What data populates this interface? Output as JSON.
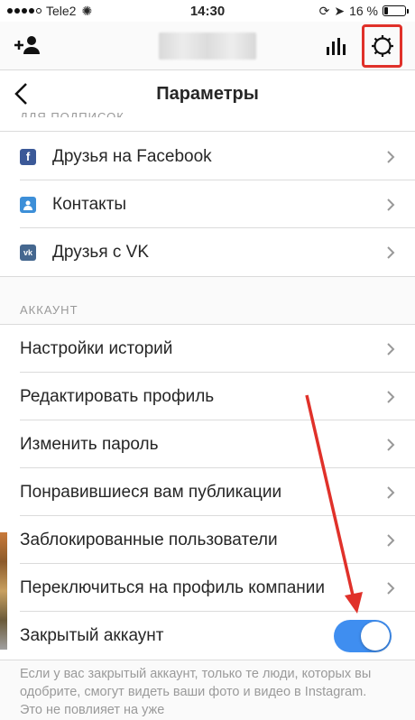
{
  "status_bar": {
    "carrier": "Tele2",
    "time": "14:30",
    "battery_text": "16 %",
    "battery_level": 0.16
  },
  "top_bar": {
    "icons": [
      "add-user-icon",
      "stats-icon",
      "gear-icon"
    ],
    "highlight_color": "#e0312a"
  },
  "nav": {
    "title": "Параметры"
  },
  "sections": {
    "follow": {
      "header_clipped": "ДЛЯ ПОДПИСОК",
      "items": [
        {
          "label": "Друзья на Facebook",
          "icon": "facebook-icon"
        },
        {
          "label": "Контакты",
          "icon": "contacts-icon"
        },
        {
          "label": "Друзья с VK",
          "icon": "vk-icon"
        }
      ]
    },
    "account": {
      "header": "АККАУНТ",
      "items": [
        {
          "label": "Настройки историй"
        },
        {
          "label": "Редактировать профиль"
        },
        {
          "label": "Изменить пароль"
        },
        {
          "label": "Понравившиеся вам публикации"
        },
        {
          "label": "Заблокированные пользователи"
        },
        {
          "label": "Переключиться на профиль компании"
        }
      ],
      "private_toggle": {
        "label": "Закрытый аккаунт",
        "on": true
      },
      "footnote": "Если у вас закрытый аккаунт, только те люди, которых вы одобрите, смогут видеть ваши фото и видео в Instagram. Это не повлияет на уже"
    }
  },
  "colors": {
    "accent": "#3f8ef0",
    "facebook": "#3b5998",
    "contacts": "#3d8fd8",
    "vk": "#45678f",
    "annotation_arrow": "#e0312a"
  }
}
